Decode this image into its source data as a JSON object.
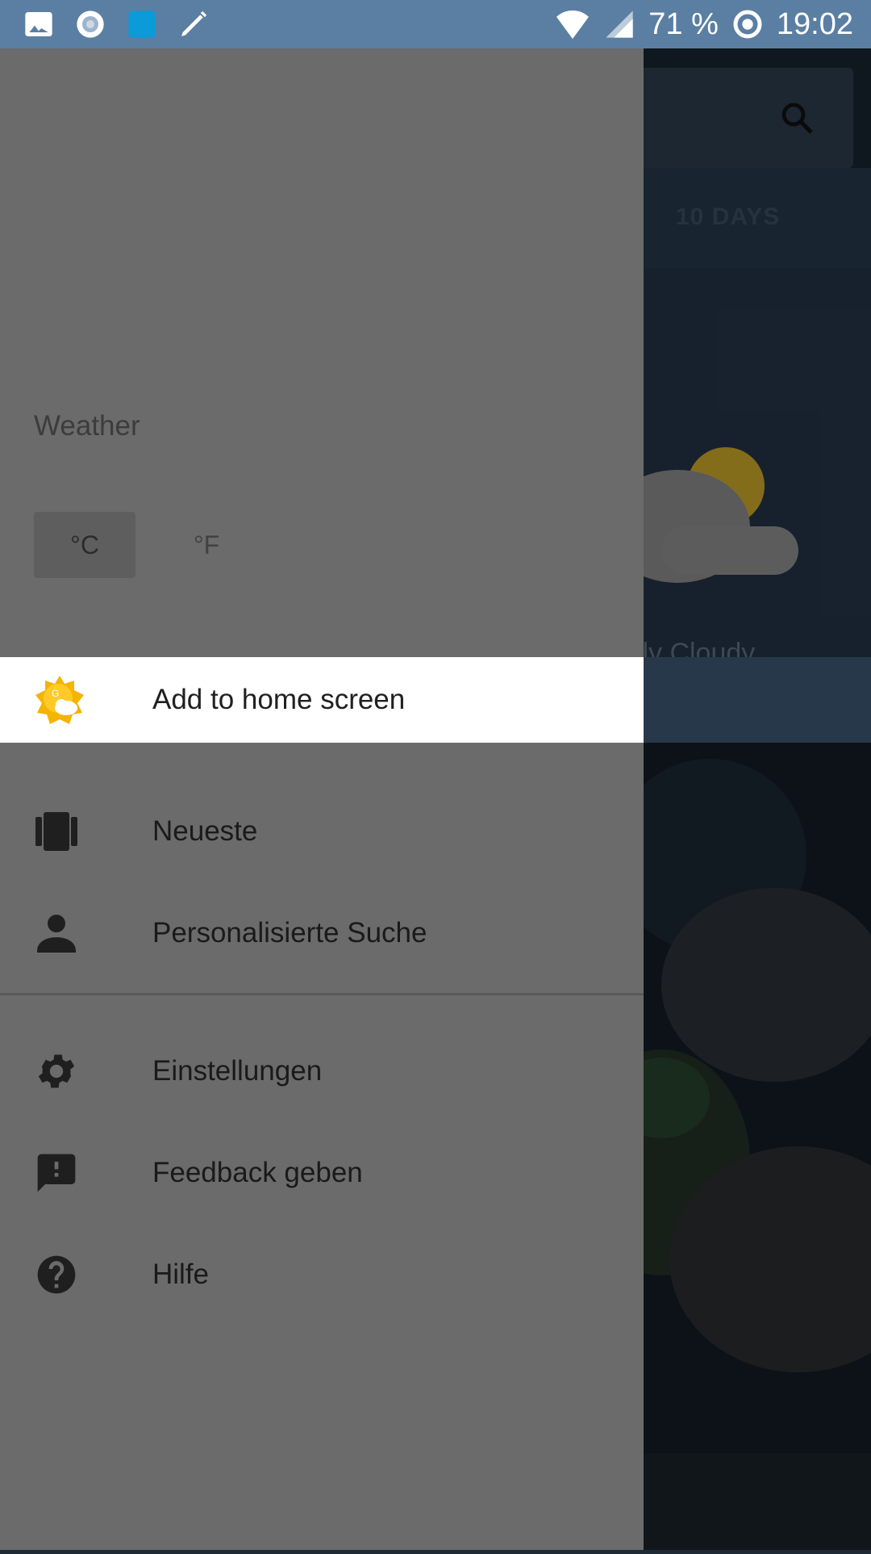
{
  "status_bar": {
    "battery_percent": "71 %",
    "time": "19:02",
    "left_icons": [
      "image-icon",
      "record-icon",
      "app-square-icon",
      "pen-icon"
    ],
    "right_icons": [
      "wifi-icon",
      "cell-signal-icon",
      "battery-ring-icon"
    ]
  },
  "background_app": {
    "tab_10_days": "10 DAYS",
    "condition": "stly Cloudy"
  },
  "drawer": {
    "title": "Weather",
    "units": {
      "celsius": "°C",
      "fahrenheit": "°F",
      "selected": "°C"
    },
    "add_to_home": "Add to home screen",
    "menu": [
      {
        "label": "Neueste",
        "icon": "cards-icon"
      },
      {
        "label": "Personalisierte Suche",
        "icon": "person-icon"
      },
      {
        "label": "Einstellungen",
        "icon": "gear-icon"
      },
      {
        "label": "Feedback geben",
        "icon": "feedback-icon"
      },
      {
        "label": "Hilfe",
        "icon": "help-icon"
      }
    ]
  },
  "colors": {
    "status_bar": "#5b7fa3",
    "drawer": "#6b6b6b",
    "highlight_row": "#ffffff"
  }
}
